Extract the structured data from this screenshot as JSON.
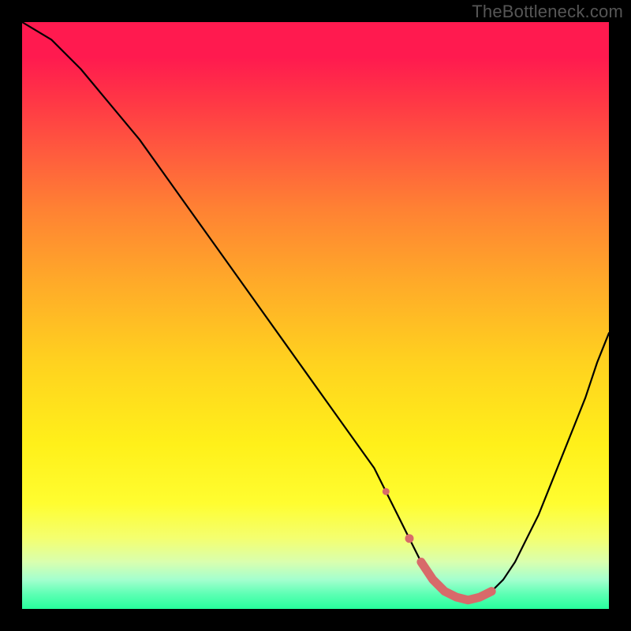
{
  "watermark": "TheBottleneck.com",
  "colors": {
    "curve": "#000000",
    "marker": "#d86a6a",
    "frame": "#000000"
  },
  "chart_data": {
    "type": "line",
    "title": "",
    "xlabel": "",
    "ylabel": "",
    "xlim": [
      0,
      100
    ],
    "ylim": [
      0,
      100
    ],
    "grid": false,
    "legend": false,
    "series": [
      {
        "name": "bottleneck-curve",
        "x": [
          0,
          5,
          10,
          15,
          20,
          25,
          30,
          35,
          40,
          45,
          50,
          55,
          60,
          62,
          64,
          66,
          68,
          70,
          72,
          74,
          76,
          78,
          80,
          82,
          84,
          86,
          88,
          90,
          92,
          94,
          96,
          98,
          100
        ],
        "values": [
          100,
          97,
          92,
          86,
          80,
          73,
          66,
          59,
          52,
          45,
          38,
          31,
          24,
          20,
          16,
          12,
          8,
          5,
          3,
          2,
          1.5,
          2,
          3,
          5,
          8,
          12,
          16,
          21,
          26,
          31,
          36,
          42,
          47
        ]
      }
    ],
    "markers": {
      "name": "highlight-points",
      "x": [
        62,
        66,
        68,
        70,
        72,
        74,
        76,
        78,
        80
      ],
      "values": [
        20,
        12,
        8,
        5,
        3,
        2,
        1.5,
        2,
        3
      ],
      "style": "dots-with-thick-segment"
    }
  }
}
